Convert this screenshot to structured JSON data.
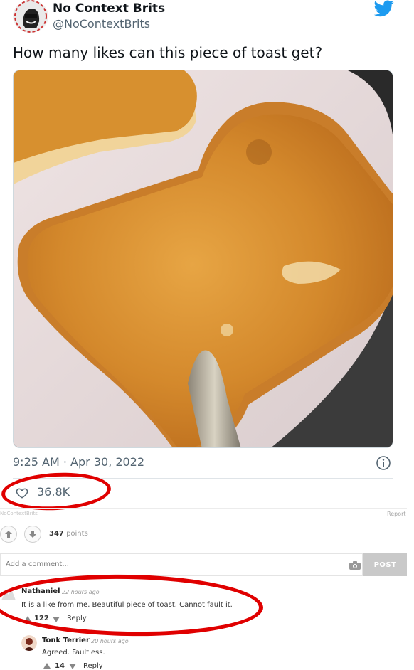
{
  "tweet": {
    "display_name": "No Context Brits",
    "handle": "@NoContextBrits",
    "text": "How many likes can this piece of toast get?",
    "timestamp": "9:25 AM · Apr 30, 2022",
    "likes": "36.8K"
  },
  "post": {
    "source": "NoContextBrits",
    "report": "Report",
    "points_value": "347",
    "points_label": "points",
    "comment_placeholder": "Add a comment...",
    "post_button": "POST"
  },
  "comments": [
    {
      "author": "Nathaniel",
      "time": "22 hours ago",
      "text": "It is a like from me. Beautiful piece of toast. Cannot fault it.",
      "votes": "122",
      "reply": "Reply"
    },
    {
      "author": "Tonk Terrier",
      "time": "20 hours ago",
      "text": "Agreed. Faultless.",
      "votes": "14",
      "reply": "Reply"
    }
  ],
  "colors": {
    "highlight": "#e00000",
    "twitter_blue": "#1d9bf0",
    "toast": "#d58a2a"
  }
}
